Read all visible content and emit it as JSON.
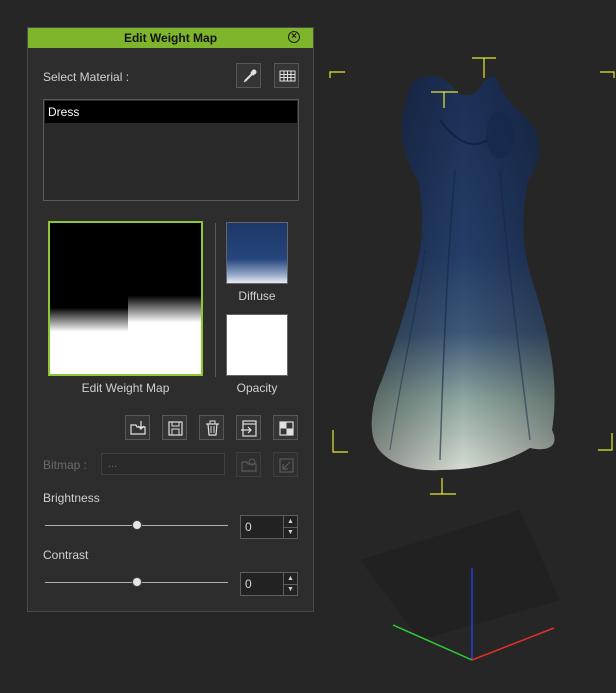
{
  "panel": {
    "title": "Edit Weight Map",
    "select_material_label": "Select Material :",
    "materials": [
      "Dress"
    ],
    "weight_map_caption": "Edit Weight Map",
    "diffuse_caption": "Diffuse",
    "opacity_caption": "Opacity",
    "bitmap_label": "Bitmap :",
    "bitmap_value": "...",
    "brightness": {
      "label": "Brightness",
      "value": "0",
      "slider_fraction": 0.5
    },
    "contrast": {
      "label": "Contrast",
      "value": "0",
      "slider_fraction": 0.5
    }
  },
  "icons": {
    "titlebar": [
      "close-icon"
    ],
    "material_tools": [
      "eyedropper-icon",
      "material-grid-icon"
    ],
    "map_tools": [
      "load-icon",
      "save-icon",
      "delete-icon",
      "export-icon",
      "checker-icon"
    ],
    "bitmap_tools": [
      "browse-bitmap-icon",
      "edit-bitmap-icon"
    ]
  },
  "colors": {
    "accent": "#7fb52a",
    "thumb_selected_border": "#8bc832",
    "bounding_box": "#e8e832",
    "dress": "#1f3560"
  }
}
